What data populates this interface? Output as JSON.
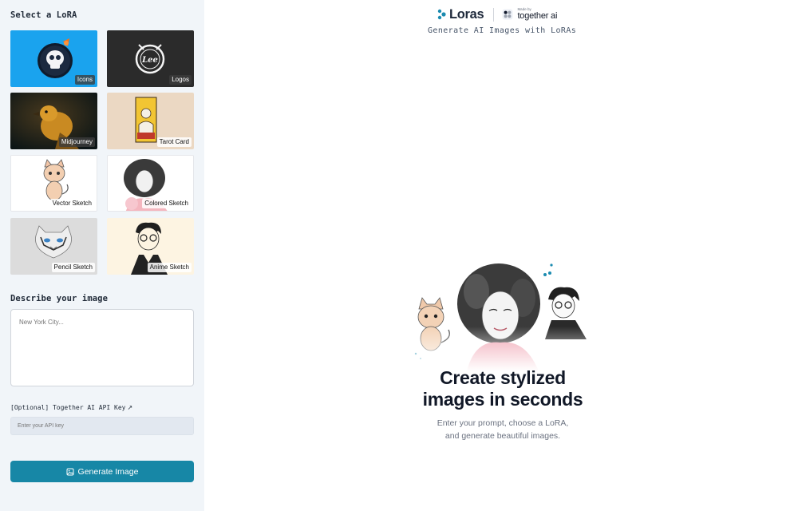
{
  "sidebar": {
    "select_title": "Select a LoRA",
    "loras": [
      {
        "label": "Icons"
      },
      {
        "label": "Logos"
      },
      {
        "label": "Midjourney"
      },
      {
        "label": "Tarot Card"
      },
      {
        "label": "Vector Sketch"
      },
      {
        "label": "Colored Sketch"
      },
      {
        "label": "Pencil Sketch"
      },
      {
        "label": "Anime Sketch"
      }
    ],
    "logo_badge_text": "Lee",
    "prompt_title": "Describe your image",
    "prompt_placeholder": "New York City...",
    "api_key_label": "[Optional] Together AI API Key",
    "api_key_arrow": "↗",
    "api_key_placeholder": "Enter your API key",
    "generate_label": "Generate Image"
  },
  "header": {
    "app_name": "Loras",
    "made_by": "Made by",
    "partner_name": "together ai",
    "subtitle": "Generate AI Images with LoRAs"
  },
  "main": {
    "headline_line1": "Create stylized",
    "headline_line2": "images in seconds",
    "tagline_line1": "Enter your prompt, choose a LoRA,",
    "tagline_line2": "and generate beautiful images."
  },
  "colors": {
    "accent": "#1787a6",
    "sidebar_bg": "#f1f5f9"
  },
  "icons": {
    "app_logo": "loras-logo-icon",
    "partner_logo": "together-ai-logo-icon",
    "generate": "image-icon",
    "external_link": "external-link-icon"
  }
}
